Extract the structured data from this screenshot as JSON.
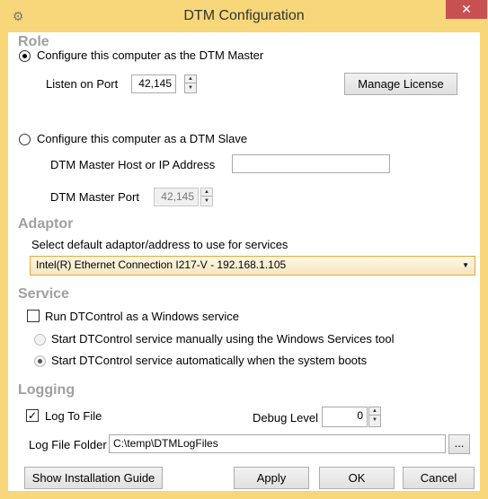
{
  "window": {
    "title": "DTM Configuration",
    "close_glyph": "✕",
    "app_icon": "app-icon"
  },
  "role": {
    "title": "Role",
    "master_label": "Configure this computer as the DTM Master",
    "listen_port_label": "Listen on Port",
    "listen_port_value": "42,145",
    "manage_license_label": "Manage License",
    "slave_label": "Configure this computer as a DTM Slave",
    "master_host_label": "DTM Master Host or IP Address",
    "master_host_value": "",
    "master_port_label": "DTM Master Port",
    "master_port_value": "42,145",
    "selected": "master"
  },
  "adaptor": {
    "title": "Adaptor",
    "select_label": "Select default adaptor/address to use for services",
    "selected_value": "Intel(R) Ethernet Connection I217-V - 192.168.1.105"
  },
  "service": {
    "title": "Service",
    "run_as_service_label": "Run DTControl as a Windows service",
    "run_as_service_checked": false,
    "manual_label": "Start DTControl service manually using the Windows Services tool",
    "auto_label": "Start DTControl service automatically when the system boots",
    "selected": "auto"
  },
  "logging": {
    "title": "Logging",
    "log_to_file_label": "Log To File",
    "log_to_file_checked": true,
    "debug_level_label": "Debug Level",
    "debug_level_value": "0",
    "folder_label": "Log File Folder",
    "folder_value": "C:\\temp\\DTMLogFiles",
    "browse_label": "..."
  },
  "footer": {
    "guide_label": "Show Installation Guide",
    "apply_label": "Apply",
    "ok_label": "OK",
    "cancel_label": "Cancel"
  },
  "glyphs": {
    "spin_up": "▲",
    "spin_down": "▼",
    "dropdown": "▼",
    "check": "✓"
  },
  "colors": {
    "frame": "#f7d77a",
    "close": "#c75050",
    "section_title": "#a0a0a0",
    "combo_border": "#e5a83a"
  }
}
